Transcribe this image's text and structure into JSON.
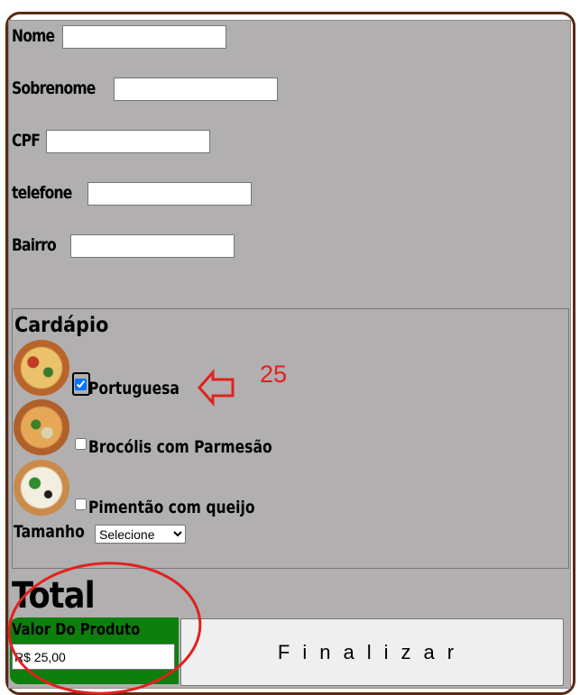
{
  "form": {
    "fields": [
      {
        "label": "Nome",
        "value": ""
      },
      {
        "label": "Sobrenome",
        "value": ""
      },
      {
        "label": "CPF",
        "value": ""
      },
      {
        "label": "telefone",
        "value": ""
      },
      {
        "label": "Bairro",
        "value": ""
      }
    ]
  },
  "menu": {
    "title": "Cardápio",
    "items": [
      {
        "label": "Portuguesa",
        "checked": true,
        "image": "pizza-portuguesa"
      },
      {
        "label": "Brocólis com Parmesão",
        "checked": false,
        "image": "pizza-brocolis"
      },
      {
        "label": "Pimentão com queijo",
        "checked": false,
        "image": "pizza-pimentao"
      }
    ],
    "size_label": "Tamanho",
    "size_selected": "Selecione"
  },
  "total": {
    "title": "Total",
    "value_label": "Valor Do Produto",
    "value": "R$ 25,00",
    "finish_label": "Finalizar"
  },
  "annotations": {
    "price_note": "25",
    "color": "#e22020"
  },
  "colors": {
    "form_bg": "#b1afaf",
    "frame_border": "#5a2a14",
    "value_box": "#0c7f0c"
  }
}
